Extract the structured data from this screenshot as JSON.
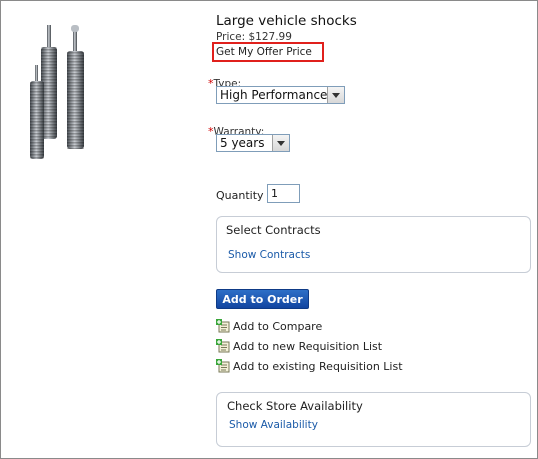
{
  "product": {
    "name": "Large vehicle shocks",
    "price_line": "Price:  $127.99",
    "offer_label": "Get My Offer Price"
  },
  "options": {
    "type": {
      "label": "Type:",
      "selected": "High Performance"
    },
    "warranty": {
      "label": "Warranty:",
      "selected": "5 years"
    }
  },
  "quantity": {
    "label": "Quantity",
    "value": "1"
  },
  "contracts": {
    "title": "Select Contracts",
    "link": "Show Contracts"
  },
  "add_to_order": "Add to Order",
  "actions": [
    {
      "label": "Add to Compare",
      "icon": "add-list-icon"
    },
    {
      "label": "Add to new Requisition List",
      "icon": "add-list-icon"
    },
    {
      "label": "Add to existing Requisition List",
      "icon": "add-list-icon"
    }
  ],
  "store": {
    "title": "Check Store Availability",
    "link": "Show Availability"
  },
  "colors": {
    "accent": "#1a5aa8",
    "highlight": "#e0201c",
    "button": "#1d57b5"
  }
}
